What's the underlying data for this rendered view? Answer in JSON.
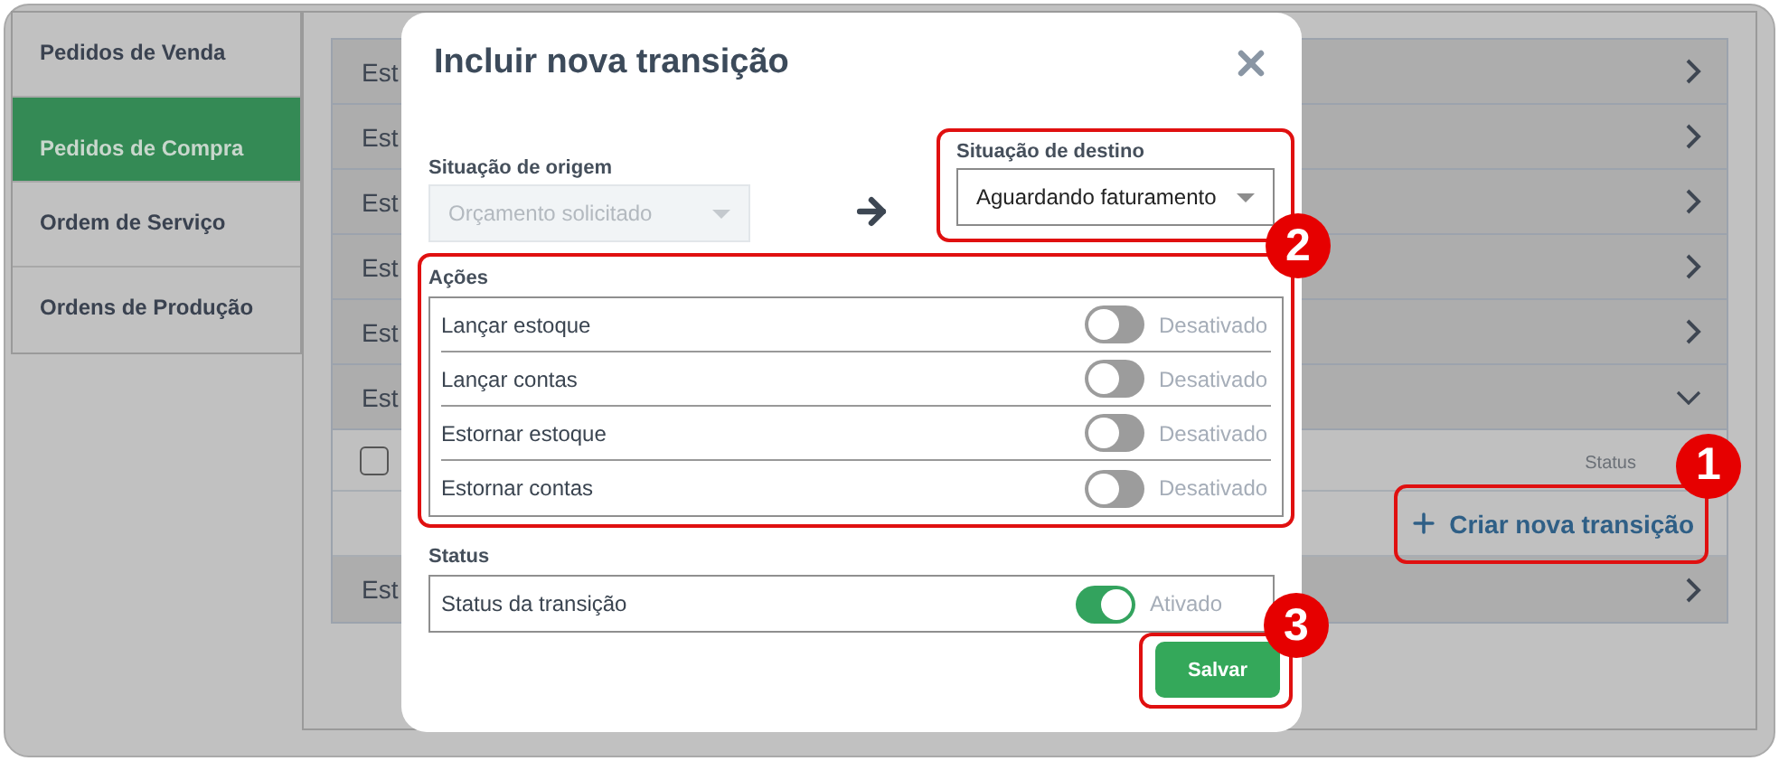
{
  "sidebar": {
    "items": [
      {
        "label": "Pedidos de Venda",
        "selected": false
      },
      {
        "label": "Pedidos de Compra",
        "selected": true
      },
      {
        "label": "Ordem de Serviço",
        "selected": false
      },
      {
        "label": "Ordens de Produção",
        "selected": false
      }
    ]
  },
  "list": {
    "items": [
      {
        "label": "Est",
        "expanded": false
      },
      {
        "label": "Est",
        "expanded": false
      },
      {
        "label": "Est",
        "expanded": false
      },
      {
        "label": "Est",
        "expanded": false
      },
      {
        "label": "Est",
        "expanded": false
      },
      {
        "label": "Est",
        "expanded": true,
        "table": {
          "checked": false,
          "column": "Status"
        },
        "create_button": {
          "label": "Criar nova transição",
          "callout": "1"
        }
      },
      {
        "label": "Est",
        "expanded": false
      }
    ]
  },
  "modal": {
    "title": "Incluir nova transição",
    "origin": {
      "label": "Situação de origem",
      "value": "Orçamento solicitado",
      "disabled": true
    },
    "destination": {
      "label": "Situação de destino",
      "value": "Aguardando faturamento",
      "disabled": false,
      "highlighted": true
    },
    "actions": {
      "label": "Ações",
      "callout": "2",
      "toggles": [
        {
          "label": "Lançar estoque",
          "on": false,
          "state_text": "Desativado"
        },
        {
          "label": "Lançar contas",
          "on": false,
          "state_text": "Desativado"
        },
        {
          "label": "Estornar estoque",
          "on": false,
          "state_text": "Desativado"
        },
        {
          "label": "Estornar contas",
          "on": false,
          "state_text": "Desativado"
        }
      ]
    },
    "status": {
      "label": "Status",
      "toggles": [
        {
          "label": "Status da transição",
          "on": true,
          "state_text": "Ativado"
        }
      ]
    },
    "save_button": {
      "label": "Salvar",
      "callout": "3"
    }
  }
}
